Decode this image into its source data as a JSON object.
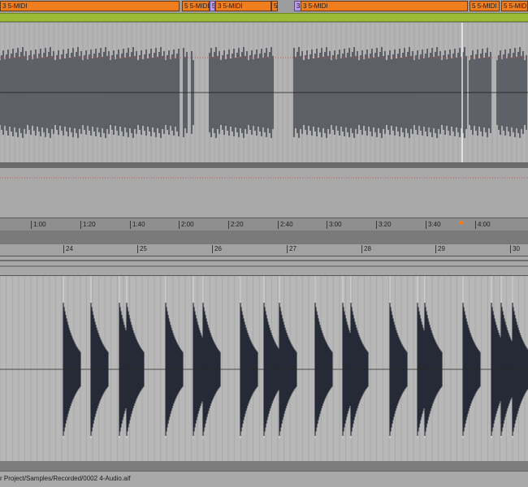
{
  "arrangement": {
    "clips": [
      {
        "label": "3 5-MIDI",
        "color": "#f07e1e"
      },
      {
        "label": "5 5-MIDI",
        "color": "#f07e1e"
      },
      {
        "label": "5",
        "color": "#b99ae6"
      },
      {
        "label": "3 5-MIDI",
        "color": "#f07e1e"
      },
      {
        "label": "5",
        "color": "#f07e1e"
      },
      {
        "label": "3",
        "color": "#b99ae6"
      },
      {
        "label": "3 5-MIDI",
        "color": "#f07e1e"
      },
      {
        "label": "5 5-MIDI",
        "color": "#f07e1e"
      },
      {
        "label": "5 5-MIDI",
        "color": "#f07e1e"
      }
    ]
  },
  "time_ruler": {
    "labels": [
      "1:00",
      "1:20",
      "1:40",
      "2:00",
      "2:20",
      "2:40",
      "3:00",
      "3:20",
      "3:40",
      "4:00"
    ]
  },
  "bar_ruler": {
    "labels": [
      "24",
      "25",
      "26",
      "27",
      "28",
      "29",
      "30"
    ]
  },
  "status": {
    "file_path": "r Project/Samples/Recorded/0002 4-Audio.aif"
  },
  "colors": {
    "clip_orange": "#f07e1e",
    "clip_violet": "#b99ae6",
    "automation_green": "#9cba34",
    "waveform": "#262a36"
  }
}
